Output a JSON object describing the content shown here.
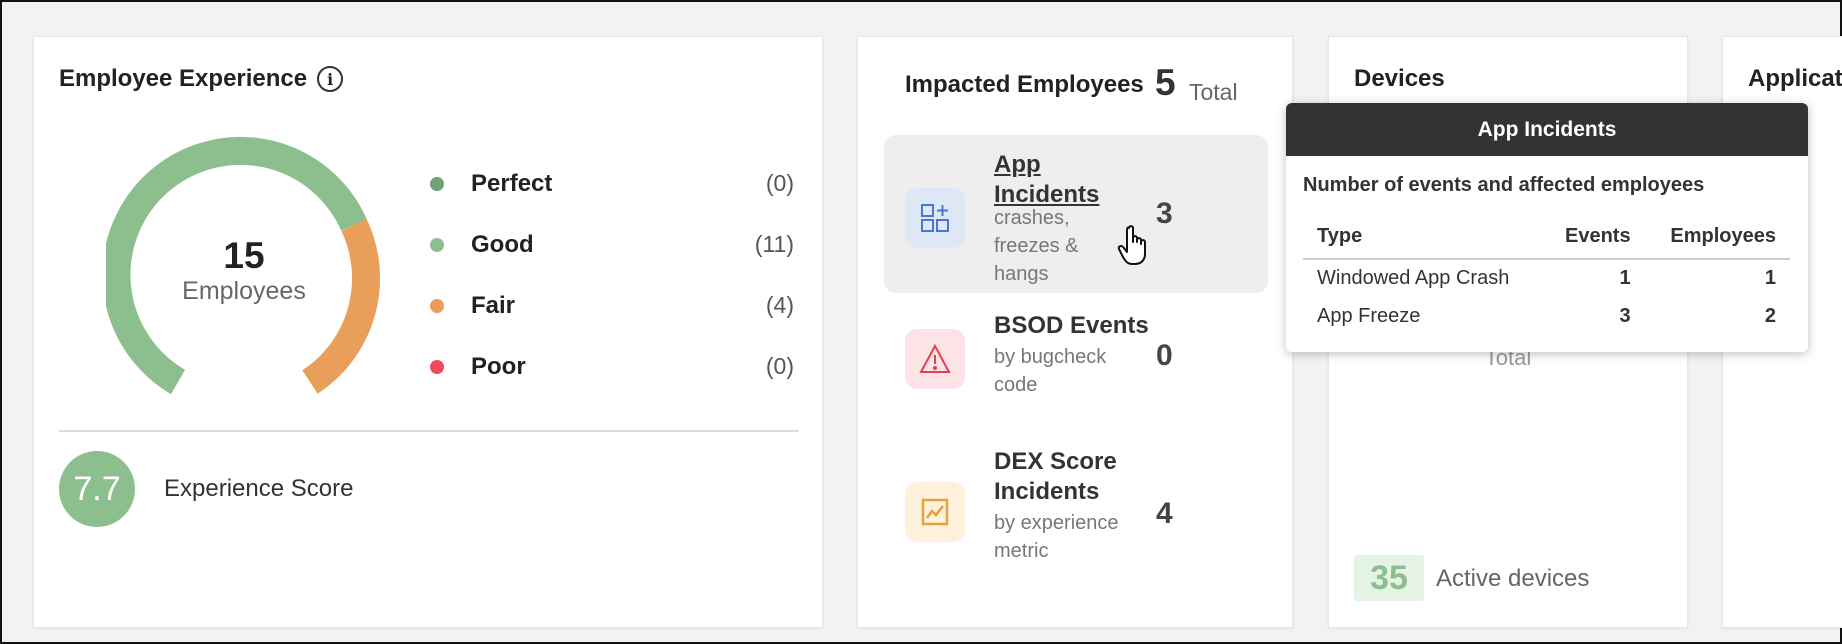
{
  "experience": {
    "title": "Employee Experience",
    "info_icon": "info-icon",
    "gauge": {
      "count": "15",
      "label": "Employees",
      "colors": {
        "good": "#8cbf8d",
        "fair": "#e99e5a"
      }
    },
    "legend": [
      {
        "name": "Perfect",
        "count": "(0)",
        "color": "#6fa274"
      },
      {
        "name": "Good",
        "count": "(11)",
        "color": "#8cbf8d"
      },
      {
        "name": "Fair",
        "count": "(4)",
        "color": "#e99e5a"
      },
      {
        "name": "Poor",
        "count": "(0)",
        "color": "#ef4a5c"
      }
    ],
    "score": {
      "value": "7.7",
      "label": "Experience Score",
      "color": "#8cbf8d"
    }
  },
  "impacted": {
    "title": "Impacted Employees",
    "total_value": "5",
    "total_label": "Total",
    "items": [
      {
        "name_line1": "App",
        "name_line2": "Incidents",
        "sub": [
          "crashes,",
          "freezes &",
          "hangs"
        ],
        "value": "3",
        "icon": "apps-add-icon"
      },
      {
        "name_line1": "BSOD Events",
        "sub": [
          "by bugcheck",
          "code"
        ],
        "value": "0",
        "icon": "warning-triangle-icon"
      },
      {
        "name_line1": "DEX Score",
        "name_line2": "Incidents",
        "sub": [
          "by experience",
          "metric"
        ],
        "value": "4",
        "icon": "trend-chart-icon"
      }
    ]
  },
  "devices": {
    "title": "Devices",
    "total_label": "Total",
    "active_value": "35",
    "active_label": "Active devices"
  },
  "applications": {
    "title": "Applicat"
  },
  "tooltip": {
    "title": "App Incidents",
    "description": "Number of events and affected employees",
    "headers": [
      "Type",
      "Events",
      "Employees"
    ],
    "rows": [
      [
        "Windowed App Crash",
        "1",
        "1"
      ],
      [
        "App Freeze",
        "3",
        "2"
      ]
    ]
  },
  "cursor_icon": "hand-pointer-icon"
}
